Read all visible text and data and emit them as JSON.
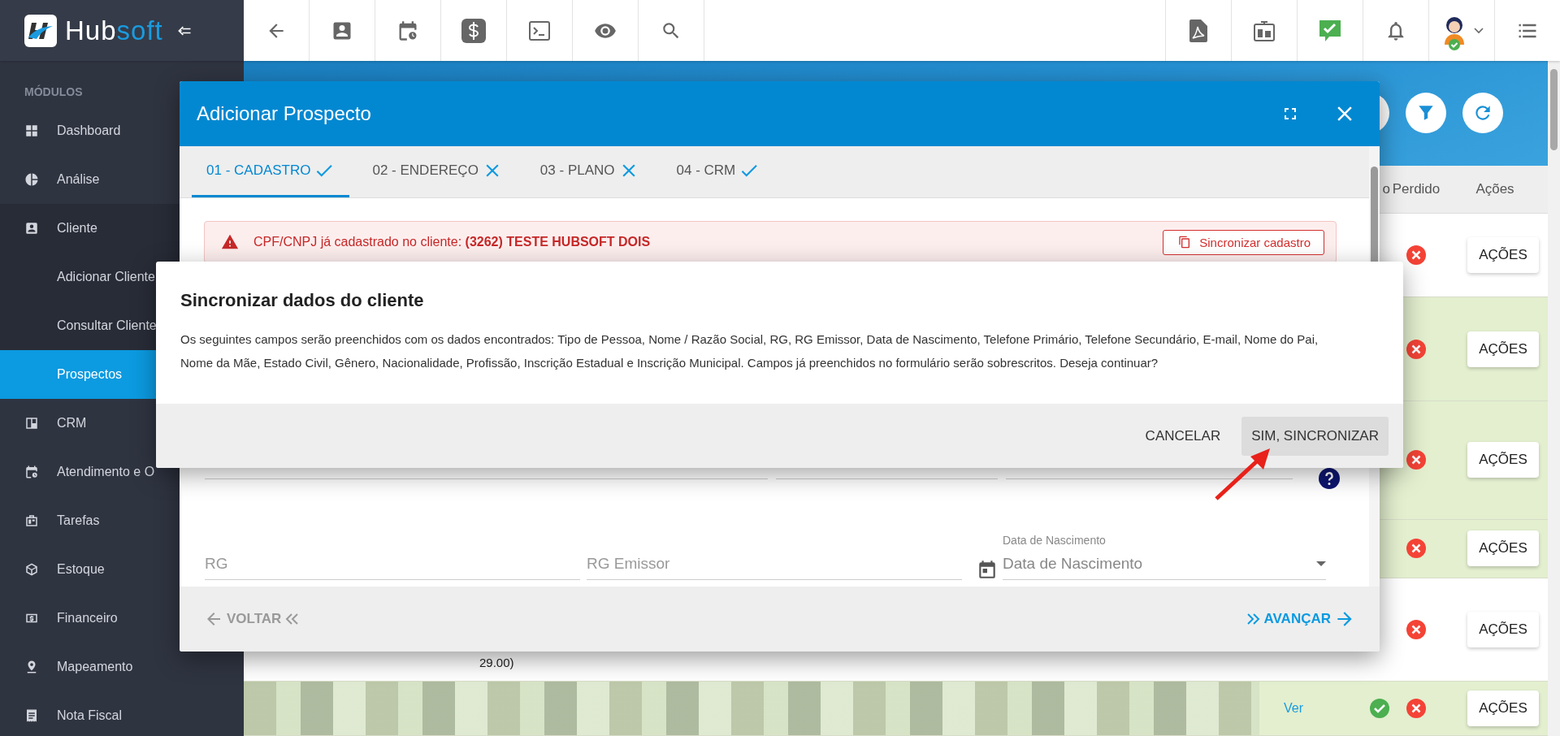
{
  "topbar": {
    "logo": {
      "main": "Hub",
      "accent": "soft"
    }
  },
  "sidebar": {
    "heading": "MÓDULOS",
    "items": [
      {
        "label": "Dashboard",
        "selected": false
      },
      {
        "label": "Análise",
        "selected": false
      },
      {
        "label": "Cliente",
        "selected": false,
        "expanded": true,
        "children": [
          {
            "label": "Adicionar Cliente",
            "selected": false
          },
          {
            "label": "Consultar Cliente",
            "selected": false
          },
          {
            "label": "Prospectos",
            "selected": true
          }
        ]
      },
      {
        "label": "CRM",
        "selected": false
      },
      {
        "label": "Atendimento e O",
        "selected": false
      },
      {
        "label": "Tarefas",
        "selected": false
      },
      {
        "label": "Estoque",
        "selected": false
      },
      {
        "label": "Financeiro",
        "selected": false
      },
      {
        "label": "Mapeamento",
        "selected": false
      },
      {
        "label": "Nota Fiscal",
        "selected": false
      }
    ]
  },
  "table": {
    "columns": [
      "o",
      "Perdido",
      "Ações"
    ],
    "rows": [
      {
        "highlighted": false,
        "won": false,
        "lost": true,
        "action": "AÇÕES"
      },
      {
        "highlighted": true,
        "won": false,
        "lost": true,
        "action": "AÇÕES"
      },
      {
        "highlighted": true,
        "won": false,
        "lost": true,
        "action": "AÇÕES"
      },
      {
        "highlighted": true,
        "won": false,
        "lost": true,
        "action": "AÇÕES"
      },
      {
        "highlighted": false,
        "won": false,
        "lost": true,
        "action": "AÇÕES",
        "cell_text": "29.00)"
      },
      {
        "highlighted": true,
        "won": true,
        "lost": true,
        "action": "AÇÕES",
        "link": "Ver"
      }
    ]
  },
  "dialog": {
    "title": "Adicionar Prospecto",
    "tabs": [
      {
        "label": "01 - CADASTRO",
        "selected": true,
        "valid": true
      },
      {
        "label": "02 - ENDEREÇO",
        "selected": false,
        "valid": false
      },
      {
        "label": "03 - PLANO",
        "selected": false,
        "valid": false
      },
      {
        "label": "04 - CRM",
        "selected": false,
        "valid": true
      }
    ],
    "alert": {
      "message": "CPF/CNPJ já cadastrado no cliente: **(3262) TESTE HUBSOFT DOIS**",
      "button": "Sincronizar cadastro"
    },
    "fields": [
      {
        "kind": "text",
        "placeholder": "RG"
      },
      {
        "kind": "text",
        "placeholder": "RG Emissor"
      },
      {
        "kind": "date",
        "label": "Data de Nascimento",
        "placeholder": "Data de Nascimento"
      }
    ],
    "back": {
      "label": "VOLTAR",
      "disabled": true
    },
    "next": {
      "label": "AVANÇAR",
      "disabled": false
    }
  },
  "confirm": {
    "title": "Sincronizar dados do cliente",
    "message": "Os seguintes campos serão preenchidos com os dados encontrados: Tipo de Pessoa, Nome / Razão Social, RG, RG Emissor, Data de Nascimento, Telefone Primário, Telefone Secundário, E-mail, Nome do Pai, Nome da Mãe, Estado Civil, Gênero, Nacionalidade, Profissão, Inscrição Estadual e Inscrição Municipal. Campos já preenchidos no formulário serão sobrescritos. Deseja continuar?",
    "buttons": [
      {
        "label": "CANCELAR",
        "focused": false
      },
      {
        "label": "SIM, SINCRONIZAR",
        "focused": true
      }
    ]
  }
}
